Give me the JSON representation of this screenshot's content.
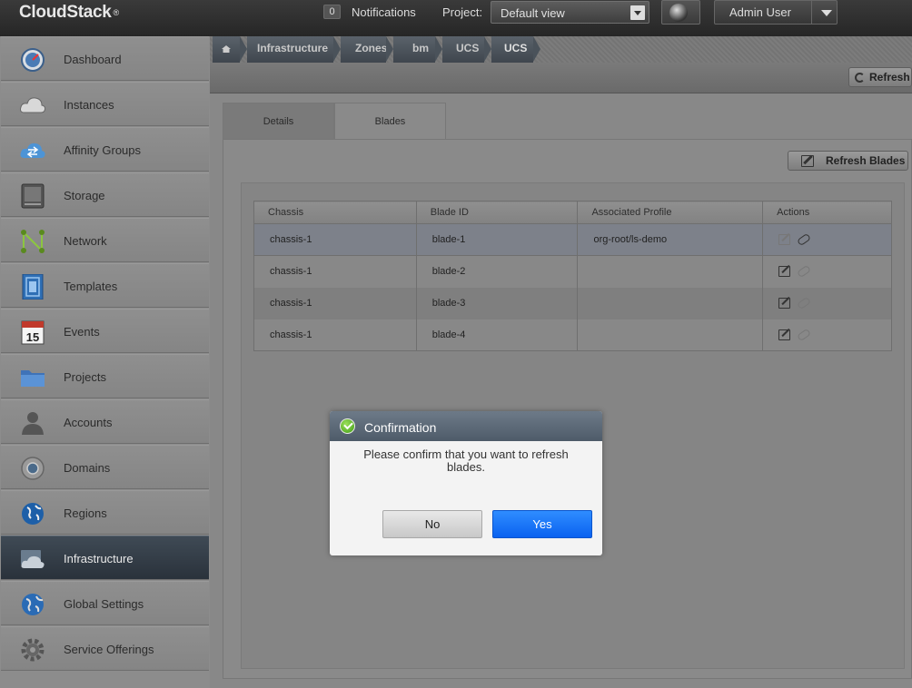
{
  "header": {
    "logo": "CloudStack",
    "logo_mark": "®",
    "notifications_count": "0",
    "notifications_label": "Notifications",
    "project_label": "Project:",
    "project_value": "Default view",
    "user_name": "Admin User"
  },
  "sidebar": {
    "items": [
      {
        "label": "Dashboard",
        "icon": "dashboard-icon"
      },
      {
        "label": "Instances",
        "icon": "cloud-icon"
      },
      {
        "label": "Affinity Groups",
        "icon": "affinity-icon"
      },
      {
        "label": "Storage",
        "icon": "storage-icon"
      },
      {
        "label": "Network",
        "icon": "network-icon"
      },
      {
        "label": "Templates",
        "icon": "templates-icon"
      },
      {
        "label": "Events",
        "icon": "calendar-icon"
      },
      {
        "label": "Projects",
        "icon": "folder-icon"
      },
      {
        "label": "Accounts",
        "icon": "user-icon"
      },
      {
        "label": "Domains",
        "icon": "domains-icon"
      },
      {
        "label": "Regions",
        "icon": "globe-icon"
      },
      {
        "label": "Infrastructure",
        "icon": "infrastructure-icon",
        "active": true
      },
      {
        "label": "Global Settings",
        "icon": "global-settings-icon"
      },
      {
        "label": "Service Offerings",
        "icon": "gear-icon"
      }
    ],
    "events_day": "15"
  },
  "breadcrumb": [
    "Infrastructure",
    "Zones",
    "bm",
    "UCS",
    "UCS"
  ],
  "toolbar": {
    "refresh_label": "Refresh"
  },
  "tabs": [
    {
      "label": "Details"
    },
    {
      "label": "Blades",
      "active": true
    }
  ],
  "panel": {
    "refresh_blades_label": "Refresh Blades"
  },
  "table": {
    "headers": [
      "Chassis",
      "Blade ID",
      "Associated Profile",
      "Actions"
    ],
    "rows": [
      {
        "chassis": "chassis-1",
        "blade_id": "blade-1",
        "profile": "org-root/ls-demo"
      },
      {
        "chassis": "chassis-1",
        "blade_id": "blade-2",
        "profile": ""
      },
      {
        "chassis": "chassis-1",
        "blade_id": "blade-3",
        "profile": ""
      },
      {
        "chassis": "chassis-1",
        "blade_id": "blade-4",
        "profile": ""
      }
    ]
  },
  "dialog": {
    "title": "Confirmation",
    "message": "Please confirm that you want to refresh blades.",
    "no_label": "No",
    "yes_label": "Yes"
  },
  "colors": {
    "yes_button": "#0a62f0",
    "active_nav": "#2a323b",
    "dialog_header": "#4e5b69"
  }
}
